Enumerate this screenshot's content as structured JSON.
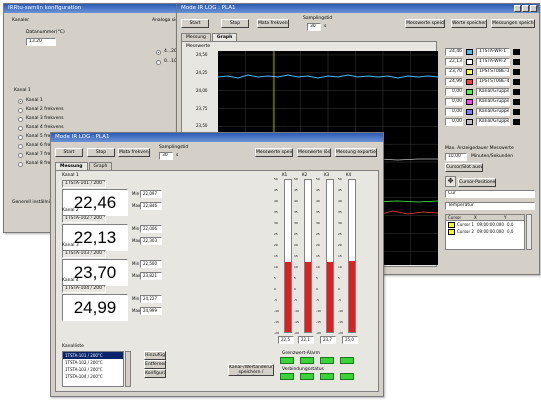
{
  "back": {
    "title": "IRRtu-samlin konfiguration",
    "tab": "Kanaler",
    "labels": [
      "Kanaler",
      "Datanummer(°C)",
      "Kanal 1"
    ],
    "field1": "13.20",
    "radios": [
      "Kanal 1",
      "Kanal 2 frekvens",
      "Kanal 3 frekvens",
      "Kanal 4 frekvens",
      "Kanal 5 frekvens",
      "Kanal 6 frekvens",
      "Kanal 7 frekvens",
      "Kanal 8 frekvens"
    ],
    "group_label": "Analoga signaler",
    "opts": [
      "4...20 mA",
      "0...10 V"
    ],
    "bottom_label": "Generell inställning"
  },
  "mid": {
    "title": "Mode IR LOG : PLA1",
    "buttons": [
      "Start",
      "Stop",
      "Mata frekvens",
      "Samplingstid",
      "Messwerte speichern",
      "Werte speichern",
      "Messungen speichern"
    ],
    "interval_label": "Samplingstid",
    "interval_value": "30",
    "interval_unit": "s",
    "tabs": [
      "Messung",
      "Graph"
    ],
    "graph_label": "Messwerte",
    "yticks": [
      "24,50",
      "24,25",
      "24,00",
      "23,75",
      "23,50",
      "23,25",
      "23,00",
      "22,75",
      "22,50",
      "22,25",
      "22,00",
      "21,75"
    ],
    "legend": [
      {
        "value": "24,46",
        "name": "1TSTA-WR-1",
        "color": "#40c0ff"
      },
      {
        "value": "22,13",
        "name": "1TSTA-WR-2",
        "color": "#ffffff"
      },
      {
        "value": "23,70",
        "name": "1PSTSTUBE-3",
        "color": "#ffff40"
      },
      {
        "value": "24,99",
        "name": "1PSTSTUBE-4",
        "color": "#ff4040"
      },
      {
        "value": "0,00",
        "name": "Kanal/Gruppe5",
        "color": "#40ff40"
      },
      {
        "value": "0,00",
        "name": "Kanal/Gruppe6",
        "color": "#ff40ff"
      },
      {
        "value": "0,00",
        "name": "Kanal/Gruppe7",
        "color": "#8080ff"
      },
      {
        "value": "0,00",
        "name": "Kanal/Gruppe8",
        "color": "#c0c0c0"
      }
    ],
    "period_label": "Max. Anzeigedauer Messwerte",
    "period_value": "10.00",
    "period_unit": "Minuten/Sekunden",
    "select_btn": "Cursor/Slot auswählen",
    "cursor_btn": "Cursor-Positionen",
    "combo1": "Cur",
    "combo2": "Temperatur",
    "table_headers": [
      "Cursor",
      "X",
      "Y"
    ],
    "table_rows": [
      {
        "name": "Cursor 1",
        "x": "09:00:00.000",
        "y": "0,0"
      },
      {
        "name": "Cursor 2",
        "x": "09:00:00.000",
        "y": "0,0"
      }
    ]
  },
  "front": {
    "title": "Mode IR LOG : PLA1",
    "buttons": [
      "Start",
      "Stop",
      "Mata frekvens"
    ],
    "interval_label": "Samplingstid",
    "interval_value": "30",
    "interval_unit": "s",
    "right_buttons": [
      "Messwerte speichern",
      "Messwerte löschen",
      "Messung exportieren"
    ],
    "tabs": [
      "Messung",
      "Graph"
    ],
    "channels": [
      {
        "title": "Kanal 1",
        "sensor": "1TSTA-101 / 200 °C",
        "value": "22,46",
        "min_label": "Min",
        "min": "22,097",
        "max_label": "Max",
        "max": "22,846"
      },
      {
        "title": "Kanal 2",
        "sensor": "1TSTA-102 / 200 °C",
        "value": "22,13",
        "min_label": "Min",
        "min": "22,006",
        "max_label": "Max",
        "max": "22,303"
      },
      {
        "title": "Kanal 3",
        "sensor": "1TSTA-103 / 200 °C",
        "value": "23,70",
        "min_label": "Min",
        "min": "22,500",
        "max_label": "Max",
        "max": "23,821"
      },
      {
        "title": "Kanal 4",
        "sensor": "1TSTA-104 / 200 °C",
        "value": "24,99",
        "min_label": "Min",
        "min": "24,227",
        "max_label": "Max",
        "max": "24,999"
      }
    ],
    "tube_labels": [
      "K1",
      "K2",
      "K3",
      "K4"
    ],
    "tube_fractions": [
      0.46,
      0.46,
      0.46,
      0.47
    ],
    "tube_ticks": [
      "50",
      "45",
      "40",
      "35",
      "30",
      "25",
      "20",
      "15",
      "10",
      "5",
      "0",
      "-5",
      "-10",
      "-15",
      "-20"
    ],
    "tube_values": [
      "22,5",
      "22,1",
      "23,7",
      "25,0"
    ],
    "led_label_1": "Grenzwert-Alarm",
    "led_label_2": "Verbindungsstatus",
    "list_label": "Kanalliste",
    "list_items": [
      "1TSTA-101 / 200°C",
      "1TSTA-102 / 200°C",
      "1TSTA-103 / 200°C",
      "1TSTA-104 / 200°C"
    ],
    "list_btns": [
      "Hinzufügen",
      "Entfernen",
      "Konfiguration"
    ],
    "apply_button": "Kanal-/Wertänderungen speichern / übernehmen"
  }
}
